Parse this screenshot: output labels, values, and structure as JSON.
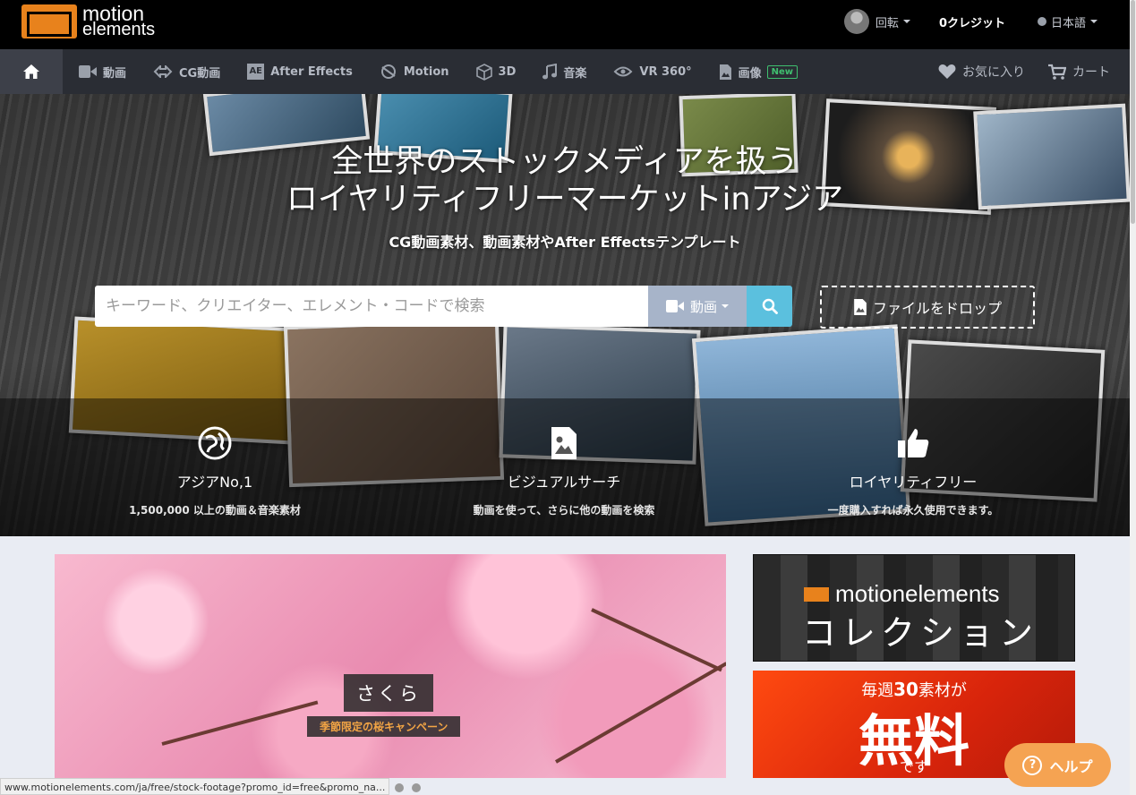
{
  "brand": {
    "line1": "motion",
    "line2": "elements"
  },
  "topbar": {
    "user_label": "回転",
    "credits": "0クレジット",
    "language": "日本語"
  },
  "nav": {
    "items": [
      {
        "label": "動画",
        "icon": "video-camera-icon"
      },
      {
        "label": "CG動画",
        "icon": "cg-motion-icon"
      },
      {
        "label": "After Effects",
        "icon": "after-effects-icon"
      },
      {
        "label": "Motion",
        "icon": "motion-icon"
      },
      {
        "label": "3D",
        "icon": "cube-icon"
      },
      {
        "label": "音楽",
        "icon": "music-note-icon"
      },
      {
        "label": "VR 360°",
        "icon": "vr-360-icon"
      },
      {
        "label": "画像",
        "icon": "image-file-icon"
      }
    ],
    "new_badge": "New",
    "favorites": "お気に入り",
    "cart": "カート"
  },
  "hero": {
    "title_line1": "全世界のストックメディアを扱う",
    "title_line2": "ロイヤリティフリーマーケットinアジア",
    "subtitle": "CG動画素材、動画素材やAfter Effectsテンプレート",
    "search_placeholder": "キーワード、クリエイター、エレメント・コードで検索",
    "search_type": "動画",
    "drop_label": "ファイルをドロップ"
  },
  "features": [
    {
      "title": "アジアNo,1",
      "subtitle": "1,500,000 以上の動画＆音楽素材",
      "icon": "globe-icon"
    },
    {
      "title": "ビジュアルサーチ",
      "subtitle": "動画を使って、さらに他の動画を検索",
      "icon": "image-search-icon"
    },
    {
      "title": "ロイヤリティフリー",
      "subtitle": "一度購入すれば永久使用できます。",
      "icon": "thumbs-up-icon"
    }
  ],
  "banner": {
    "title": "さくら",
    "subtitle": "季節限定の桜キャンペーン"
  },
  "side_collection": {
    "brand": "motionelements",
    "title": "コレクション"
  },
  "side_free": {
    "line1_prefix": "毎週",
    "line1_number": "30",
    "line1_suffix": "素材が",
    "big": "無料",
    "line3": "です"
  },
  "help": {
    "label": "ヘルプ"
  },
  "status_url": "www.motionelements.com/ja/free/stock-footage?promo_id=free&promo_na...",
  "colors": {
    "accent": "#e8821c",
    "search_btn": "#5bc0de",
    "nav_bg": "#2a2d34",
    "help_btn": "#f5a352"
  }
}
